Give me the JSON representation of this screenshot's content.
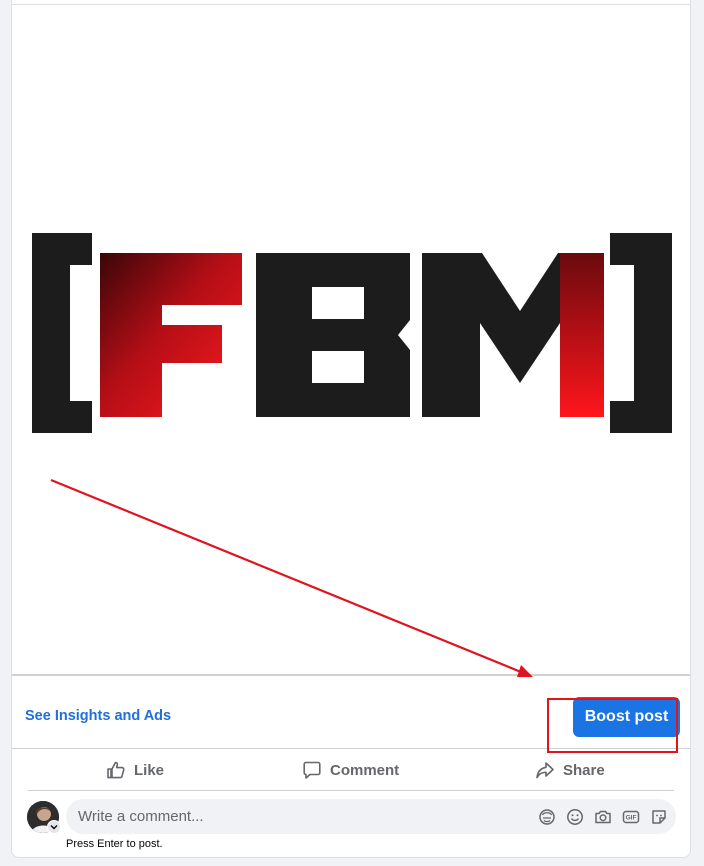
{
  "post_media": {
    "logo_text": "FBM",
    "accent_color": "#e0141e",
    "dark_color": "#1b1b1b"
  },
  "promo_bar": {
    "insights_link": "See Insights and Ads",
    "boost_label": "Boost post"
  },
  "actions": {
    "like_label": "Like",
    "comment_label": "Comment",
    "share_label": "Share"
  },
  "composer": {
    "placeholder": "Write a comment...",
    "hint": "Press Enter to post.",
    "tools": [
      "avatar-sticker-icon",
      "emoji-icon",
      "camera-icon",
      "gif-icon",
      "sticker-icon"
    ]
  },
  "colors": {
    "brand_blue": "#1b74e4",
    "link_blue": "#216fdb",
    "annotation_red": "#e0141e"
  }
}
